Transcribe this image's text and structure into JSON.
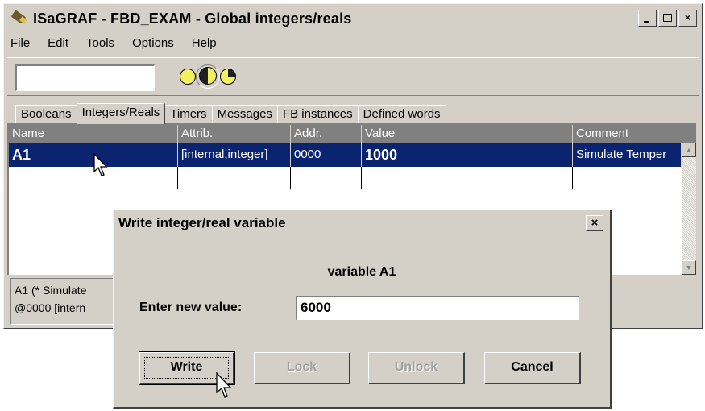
{
  "window": {
    "title": "ISaGRAF - FBD_EXAM - Global integers/reals",
    "controls": {
      "minimize": "",
      "maximize": "",
      "close": "×"
    }
  },
  "menu": [
    "File",
    "Edit",
    "Tools",
    "Options",
    "Help"
  ],
  "toolbar": {
    "input_value": "",
    "icons": [
      "yellow-circle-icon",
      "half-circle-icon",
      "quarter-circle-icon"
    ]
  },
  "tabs": [
    "Booleans",
    "Integers/Reals",
    "Timers",
    "Messages",
    "FB instances",
    "Defined words"
  ],
  "active_tab": "Integers/Reals",
  "grid": {
    "columns": [
      "Name",
      "Attrib.",
      "Addr.",
      "Value",
      "Comment"
    ],
    "rows": [
      {
        "name": "A1",
        "attrib": "[internal,integer]",
        "addr": "0000",
        "value": "1000",
        "comment": "Simulate Temper"
      }
    ]
  },
  "status": {
    "line1": "A1   (* Simulate",
    "line2": "@0000  [intern"
  },
  "dialog": {
    "title": "Write integer/real variable",
    "close": "×",
    "variable_label": "variable A1",
    "enter_label": "Enter new value:",
    "input_value": "6000",
    "buttons": {
      "write": "Write",
      "lock": "Lock",
      "unlock": "Unlock",
      "cancel": "Cancel"
    }
  },
  "colors": {
    "face": "#d4d0c8",
    "selection": "#0a2470",
    "header": "#808080"
  }
}
